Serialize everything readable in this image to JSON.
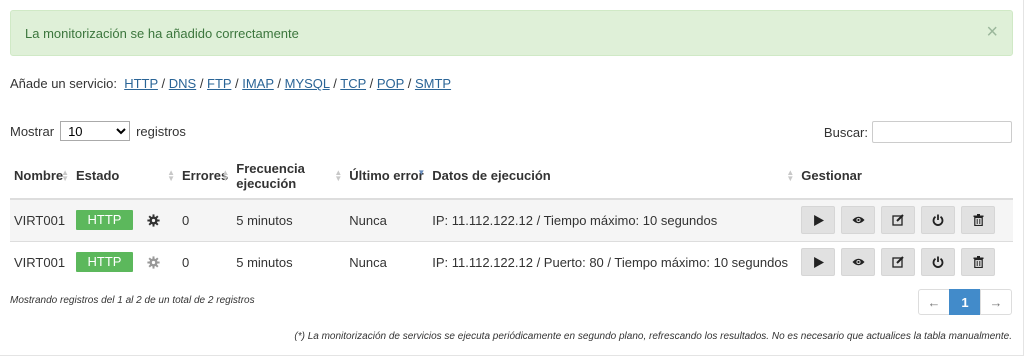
{
  "alert": {
    "message": "La monitorización se ha añadido correctamente",
    "close_glyph": "×"
  },
  "services": {
    "label": "Añade un servicio:",
    "links": [
      "HTTP",
      "DNS",
      "FTP",
      "IMAP",
      "MYSQL",
      "TCP",
      "POP",
      "SMTP"
    ],
    "separator": " / "
  },
  "length": {
    "prefix": "Mostrar",
    "selected": "10",
    "suffix": "registros"
  },
  "search": {
    "label": "Buscar:",
    "value": "",
    "placeholder": ""
  },
  "table": {
    "headers": {
      "name": "Nombre",
      "state": "Estado",
      "errors": "Errores",
      "frequency_line1": "Frecuencia",
      "frequency_line2": "ejecución",
      "last_error": "Último error",
      "exec_data": "Datos de ejecución",
      "manage": "Gestionar"
    },
    "rows": [
      {
        "name": "VIRT001",
        "state": "HTTP",
        "errors": "0",
        "frequency": "5 minutos",
        "last_error": "Nunca",
        "exec_data": "IP: 11.112.122.12 / Tiempo máximo: 10 segundos"
      },
      {
        "name": "VIRT001",
        "state": "HTTP",
        "errors": "0",
        "frequency": "5 minutos",
        "last_error": "Nunca",
        "exec_data": "IP: 11.112.122.12 / Puerto: 80 / Tiempo máximo: 10 segundos"
      }
    ]
  },
  "info": "Mostrando registros del 1 al 2 de un total de 2 registros",
  "pagination": {
    "prev": "←",
    "current": "1",
    "next": "→"
  },
  "footnote": "(*) La monitorización de servicios se ejecuta periódicamente en segundo plano, refrescando los resultados. No es necesario que actualices la tabla manualmente.",
  "icons": {
    "settings": "gear-icon",
    "actions": [
      "play-icon",
      "eye-icon",
      "edit-icon",
      "power-icon",
      "trash-icon"
    ]
  },
  "colors": {
    "alert_bg": "#dff0d8",
    "alert_text": "#3c763d",
    "badge": "#5cb85c",
    "link": "#2a6496",
    "pager_active": "#428bca"
  }
}
